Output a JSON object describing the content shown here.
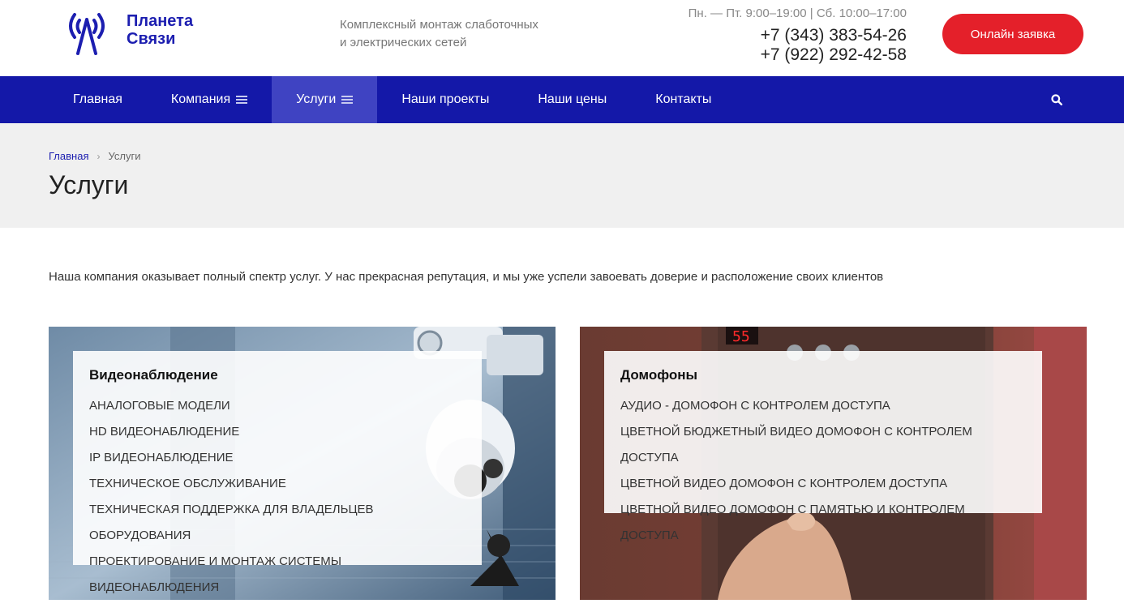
{
  "brand": {
    "line1": "Планета",
    "line2": "Связи",
    "color": "#1c1eb0"
  },
  "tagline": {
    "line1": "Комплексный монтаж слаботочных",
    "line2": "и электрических сетей"
  },
  "contact": {
    "hours": "Пн. — Пт. 9:00–19:00 | Сб. 10:00–17:00",
    "phone1": "+7 (343) 383-54-26",
    "phone2": "+7 (922) 292-42-58"
  },
  "cta_label": "Онлайн заявка",
  "nav": {
    "items": [
      {
        "label": "Главная"
      },
      {
        "label": "Компания"
      },
      {
        "label": "Услуги"
      },
      {
        "label": "Наши проекты"
      },
      {
        "label": "Наши цены"
      },
      {
        "label": "Контакты"
      }
    ],
    "search_icon": "search-icon"
  },
  "breadcrumb": {
    "home": "Главная",
    "current": "Услуги"
  },
  "page_title": "Услуги",
  "intro": "Наша компания оказывает полный спектр услуг. У нас прекрасная репутация, и мы уже успели завоевать доверие и расположение своих клиентов",
  "cards": [
    {
      "title": "Видеонаблюдение",
      "links": [
        "АНАЛОГОВЫЕ МОДЕЛИ",
        "HD ВИДЕОНАБЛЮДЕНИЕ",
        "IP ВИДЕОНАБЛЮДЕНИЕ",
        "ТЕХНИЧЕСКОЕ ОБСЛУЖИВАНИЕ",
        "ТЕХНИЧЕСКАЯ ПОДДЕРЖКА ДЛЯ ВЛАДЕЛЬЦЕВ ОБОРУДОВАНИЯ",
        "ПРОЕКТИРОВАНИЕ И МОНТАЖ СИСТЕМЫ ВИДЕОНАБЛЮДЕНИЯ"
      ]
    },
    {
      "title": "Домофоны",
      "display_digits": "55",
      "links": [
        "АУДИО - ДОМОФОН С КОНТРОЛЕМ ДОСТУПА",
        "ЦВЕТНОЙ БЮДЖЕТНЫЙ ВИДЕО ДОМОФОН С КОНТРОЛЕМ ДОСТУПА",
        "ЦВЕТНОЙ ВИДЕО ДОМОФОН С КОНТРОЛЕМ ДОСТУПА",
        "ЦВЕТНОЙ ВИДЕО ДОМОФОН С ПАМЯТЬЮ И КОНТРОЛЕМ ДОСТУПА"
      ]
    }
  ],
  "colors": {
    "nav_bg": "#1418a8",
    "nav_active": "#3f43c2",
    "cta": "#e4202a"
  }
}
